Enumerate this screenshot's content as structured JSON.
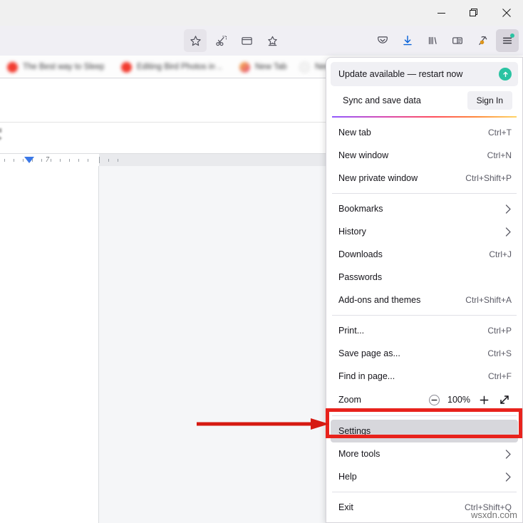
{
  "window": {
    "controls": [
      {
        "name": "minimize",
        "glyph": "minimize-icon"
      },
      {
        "name": "restore",
        "glyph": "restore-icon"
      },
      {
        "name": "close",
        "glyph": "close-icon"
      }
    ]
  },
  "toolbar": {
    "left_icons": [
      {
        "name": "bookmark-star-icon",
        "label": "Bookmark this page"
      },
      {
        "name": "screenshot-scissors-icon",
        "label": "Take a screenshot"
      },
      {
        "name": "reader-view-icon",
        "label": "Reader view"
      },
      {
        "name": "save-to-pocket-icon",
        "label": "Save to Pocket"
      }
    ],
    "right_icons": [
      {
        "name": "pocket-icon",
        "label": "Pocket"
      },
      {
        "name": "downloads-icon",
        "label": "Downloads"
      },
      {
        "name": "library-icon",
        "label": "Library"
      },
      {
        "name": "sidebars-icon",
        "label": "Sidebars"
      },
      {
        "name": "extension-pickaxe-icon",
        "label": "Extension"
      },
      {
        "name": "app-menu-icon",
        "label": "Open application menu"
      }
    ]
  },
  "tabs": [
    {
      "title": "The Best way to Sleep ...",
      "favicon_color": "#f23b2f"
    },
    {
      "title": "Editing Bird Photos in ...",
      "favicon_color": "#f23b2f"
    },
    {
      "title": "New Tab",
      "favicon_color": "#e8517d"
    },
    {
      "title": "New",
      "favicon_color": "#ffffff"
    }
  ],
  "document_page": {
    "ruler_label": "7",
    "ruler_visible": true
  },
  "menu": {
    "update": {
      "text": "Update available — restart now",
      "badge_icon": "arrow-up-circle-icon",
      "badge_color": "#2ac3a2"
    },
    "sync": {
      "label": "Sync and save data",
      "button_label": "Sign In"
    },
    "groups": [
      {
        "items": [
          {
            "label": "New tab",
            "accel": "Ctrl+T",
            "arrow": false
          },
          {
            "label": "New window",
            "accel": "Ctrl+N",
            "arrow": false
          },
          {
            "label": "New private window",
            "accel": "Ctrl+Shift+P",
            "arrow": false
          }
        ]
      },
      {
        "items": [
          {
            "label": "Bookmarks",
            "accel": "",
            "arrow": true
          },
          {
            "label": "History",
            "accel": "",
            "arrow": true
          },
          {
            "label": "Downloads",
            "accel": "Ctrl+J",
            "arrow": false
          },
          {
            "label": "Passwords",
            "accel": "",
            "arrow": false
          },
          {
            "label": "Add-ons and themes",
            "accel": "Ctrl+Shift+A",
            "arrow": false
          }
        ]
      },
      {
        "items": [
          {
            "label": "Print...",
            "accel": "Ctrl+P",
            "arrow": false
          },
          {
            "label": "Save page as...",
            "accel": "Ctrl+S",
            "arrow": false
          },
          {
            "label": "Find in page...",
            "accel": "Ctrl+F",
            "arrow": false
          }
        ]
      }
    ],
    "zoom": {
      "label": "Zoom",
      "level": "100%",
      "minus_icon": "zoom-out-icon",
      "plus_icon": "zoom-in-icon",
      "fullscreen_icon": "fullscreen-icon"
    },
    "settings": {
      "label": "Settings",
      "accel": "",
      "arrow": false,
      "highlighted": true
    },
    "after_settings": [
      {
        "label": "More tools",
        "accel": "",
        "arrow": true
      },
      {
        "label": "Help",
        "accel": "",
        "arrow": true
      }
    ],
    "exit": {
      "label": "Exit",
      "accel": "Ctrl+Shift+Q",
      "arrow": false
    }
  },
  "annotations": {
    "highlight_color": "#e8221c",
    "arrow_color": "#d61a12",
    "target": "Settings"
  },
  "watermark": {
    "text": "wsxdn.com"
  }
}
